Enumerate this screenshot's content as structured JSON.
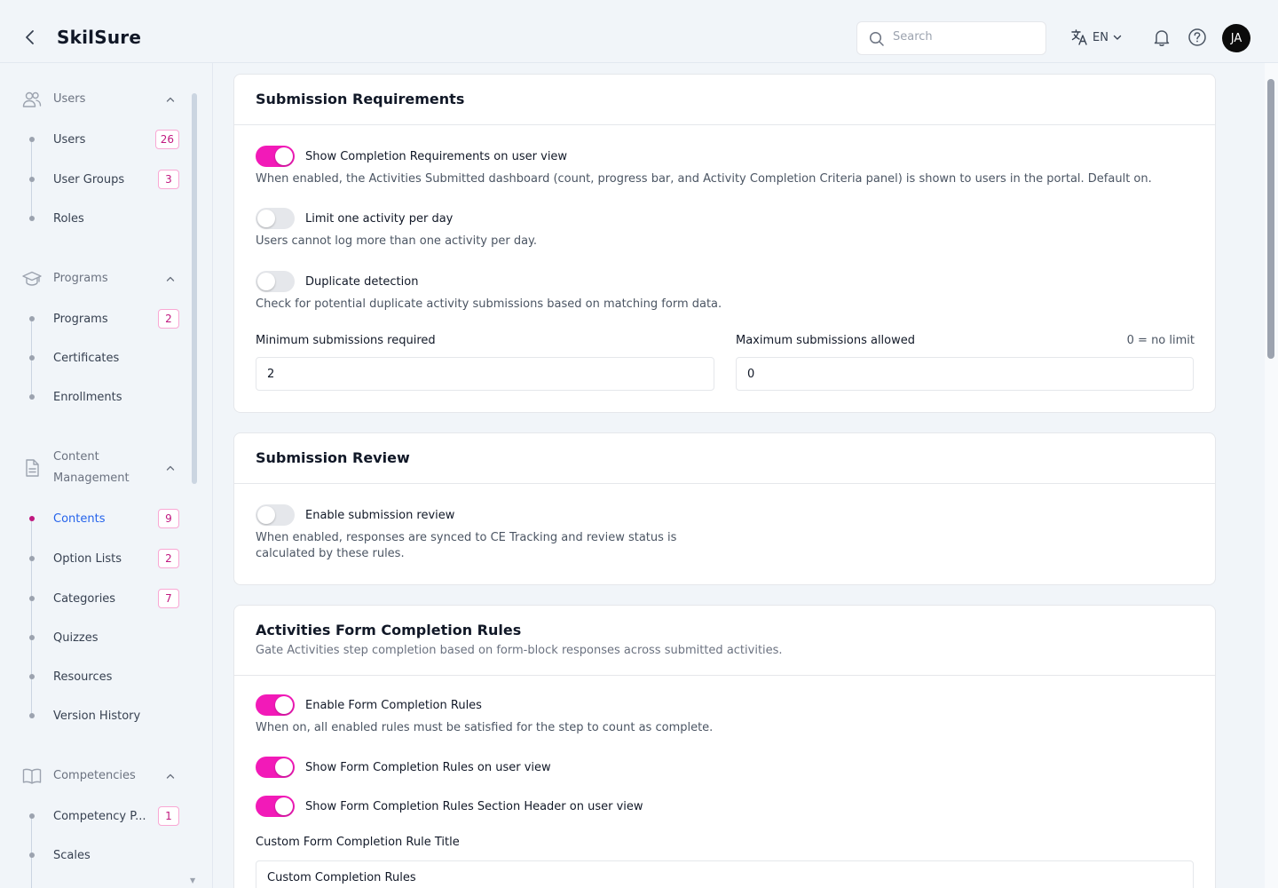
{
  "header": {
    "app_title": "SkilSure",
    "search_placeholder": "Search",
    "language": "EN",
    "avatar_initials": "JA"
  },
  "sidebar": {
    "sections": [
      {
        "label": "Users",
        "items": [
          {
            "label": "Users",
            "badge": "26"
          },
          {
            "label": "User Groups",
            "badge": "3"
          },
          {
            "label": "Roles",
            "badge": ""
          }
        ]
      },
      {
        "label": "Programs",
        "items": [
          {
            "label": "Programs",
            "badge": "2"
          },
          {
            "label": "Certificates",
            "badge": ""
          },
          {
            "label": "Enrollments",
            "badge": ""
          }
        ]
      },
      {
        "label": "Content Management",
        "items": [
          {
            "label": "Contents",
            "badge": "9",
            "active": true
          },
          {
            "label": "Option Lists",
            "badge": "2"
          },
          {
            "label": "Categories",
            "badge": "7"
          },
          {
            "label": "Quizzes",
            "badge": ""
          },
          {
            "label": "Resources",
            "badge": ""
          },
          {
            "label": "Version History",
            "badge": ""
          }
        ]
      },
      {
        "label": "Competencies",
        "items": [
          {
            "label": "Competency P...",
            "badge": "1"
          },
          {
            "label": "Scales",
            "badge": ""
          }
        ]
      }
    ]
  },
  "submission_requirements": {
    "title": "Submission Requirements",
    "show_completion": {
      "label": "Show Completion Requirements on user view",
      "on": true,
      "desc": "When enabled, the Activities Submitted dashboard (count, progress bar, and Activity Completion Criteria panel) is shown to users in the portal. Default on."
    },
    "limit_one": {
      "label": "Limit one activity per day",
      "on": false,
      "desc": "Users cannot log more than one activity per day."
    },
    "duplicate": {
      "label": "Duplicate detection",
      "on": false,
      "desc": "Check for potential duplicate activity submissions based on matching form data."
    },
    "min_label": "Minimum submissions required",
    "min_value": "2",
    "max_label": "Maximum submissions allowed",
    "max_hint": "0 = no limit",
    "max_value": "0"
  },
  "submission_review": {
    "title": "Submission Review",
    "enable": {
      "label": "Enable submission review",
      "on": false,
      "desc_line1": "When enabled, responses are synced to CE Tracking and review status is",
      "desc_line2": "calculated by these rules."
    }
  },
  "form_completion": {
    "title": "Activities Form Completion Rules",
    "subtitle": "Gate Activities step completion based on form-block responses across submitted activities.",
    "enable": {
      "label": "Enable Form Completion Rules",
      "on": true,
      "desc": "When on, all enabled rules must be satisfied for the step to count as complete."
    },
    "show_rules": {
      "label": "Show Form Completion Rules on user view",
      "on": true
    },
    "show_header": {
      "label": "Show Form Completion Rules Section Header on user view",
      "on": true
    },
    "custom_title_label": "Custom Form Completion Rule Title",
    "custom_title_value": "Custom Completion Rules"
  },
  "colors": {
    "accent": "#f21ab8",
    "badge_text": "#c0187f",
    "active_link": "#2563eb"
  }
}
